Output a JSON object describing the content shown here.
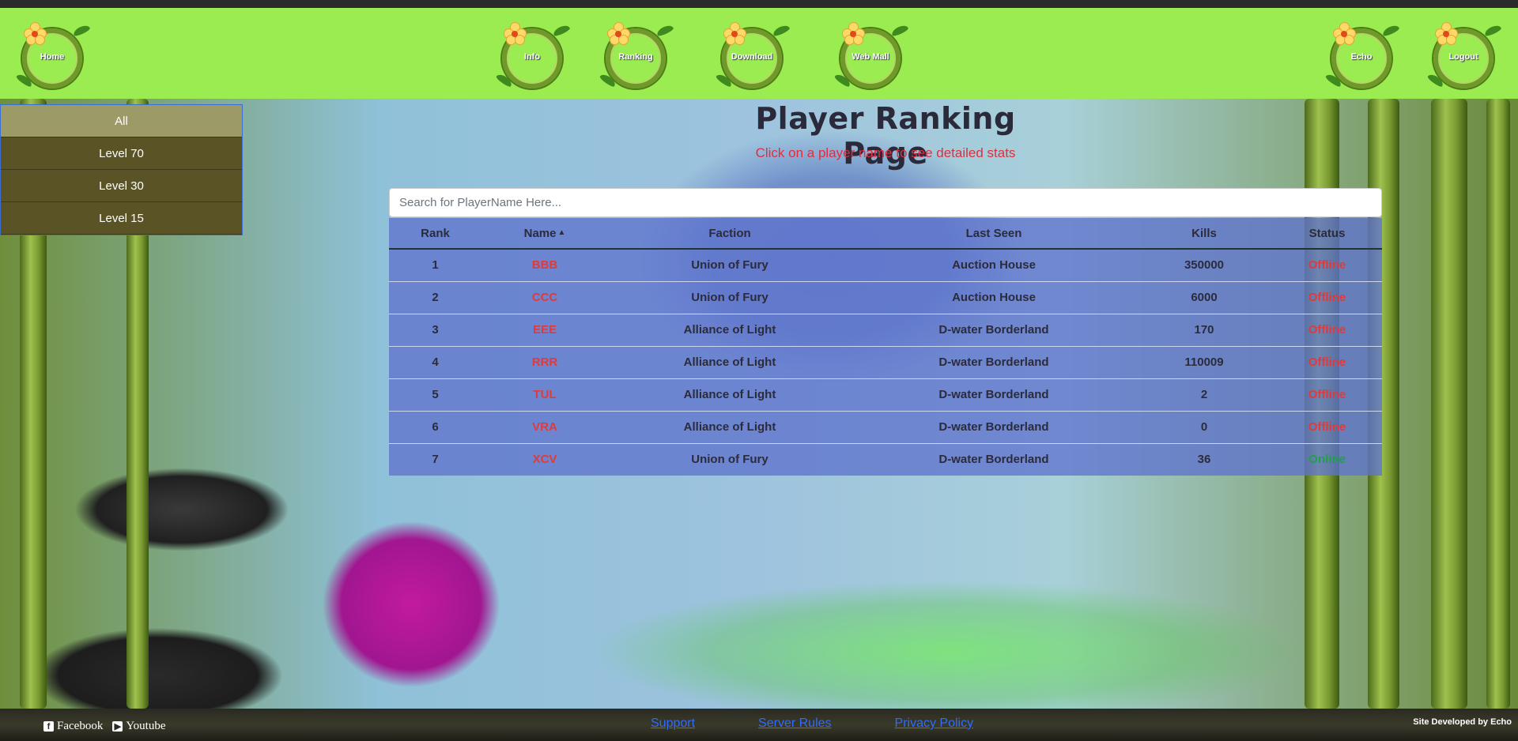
{
  "nav": {
    "items": [
      {
        "label": "Home",
        "icon": "bamboo-ring-icon"
      },
      {
        "label": "Info",
        "icon": "bamboo-ring-icon"
      },
      {
        "label": "Ranking",
        "icon": "bamboo-ring-icon"
      },
      {
        "label": "Download",
        "icon": "bamboo-ring-icon"
      },
      {
        "label": "Web Mall",
        "icon": "bamboo-ring-icon"
      },
      {
        "label": "Echo",
        "icon": "bamboo-ring-icon"
      },
      {
        "label": "Logout",
        "icon": "bamboo-ring-icon"
      }
    ]
  },
  "sidebar": {
    "items": [
      {
        "label": "All",
        "active": true
      },
      {
        "label": "Level 70",
        "active": false
      },
      {
        "label": "Level 30",
        "active": false
      },
      {
        "label": "Level 15",
        "active": false
      }
    ]
  },
  "header": {
    "title": "Player Ranking Page",
    "subtitle": "Click on a player name to see detailed stats"
  },
  "search": {
    "placeholder": "Search for PlayerName Here..."
  },
  "table": {
    "columns": [
      "Rank",
      "Name",
      "Faction",
      "Last Seen",
      "Kills",
      "Status"
    ],
    "sorted_column": "Name",
    "rows": [
      {
        "rank": "1",
        "name": "BBB",
        "faction": "Union of Fury",
        "last_seen": "Auction House",
        "kills": "350000",
        "status": "Offline"
      },
      {
        "rank": "2",
        "name": "CCC",
        "faction": "Union of Fury",
        "last_seen": "Auction House",
        "kills": "6000",
        "status": "Offline"
      },
      {
        "rank": "3",
        "name": "EEE",
        "faction": "Alliance of Light",
        "last_seen": "D-water Borderland",
        "kills": "170",
        "status": "Offline"
      },
      {
        "rank": "4",
        "name": "RRR",
        "faction": "Alliance of Light",
        "last_seen": "D-water Borderland",
        "kills": "110009",
        "status": "Offline"
      },
      {
        "rank": "5",
        "name": "TUL",
        "faction": "Alliance of Light",
        "last_seen": "D-water Borderland",
        "kills": "2",
        "status": "Offline"
      },
      {
        "rank": "6",
        "name": "VRA",
        "faction": "Alliance of Light",
        "last_seen": "D-water Borderland",
        "kills": "0",
        "status": "Offline"
      },
      {
        "rank": "7",
        "name": "XCV",
        "faction": "Union of Fury",
        "last_seen": "D-water Borderland",
        "kills": "36",
        "status": "Online"
      }
    ]
  },
  "footer": {
    "social": [
      {
        "label": "Facebook",
        "icon": "facebook-icon"
      },
      {
        "label": "Youtube",
        "icon": "youtube-icon"
      }
    ],
    "links": [
      "Support",
      "Server Rules",
      "Privacy Policy"
    ],
    "credit": "Site Developed by Echo"
  },
  "colors": {
    "navbar": "#9bec50",
    "sidebar": "#5a5326",
    "sidebar_active": "#9c9a66",
    "table_bg": "#5f73cd",
    "offline": "#e03a3a",
    "online": "#1fa04a",
    "subtitle": "#e52c3c",
    "link": "#2f6bff"
  }
}
